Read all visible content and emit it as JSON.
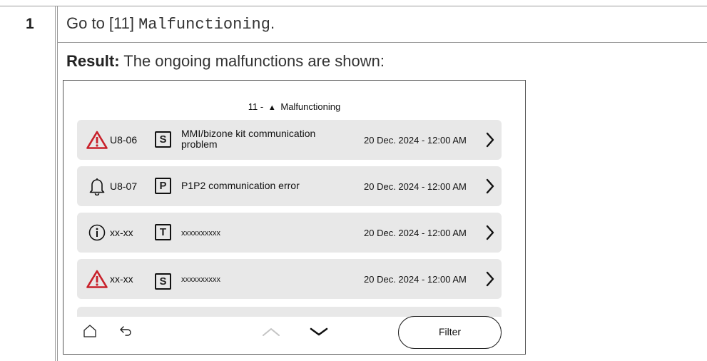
{
  "step": {
    "number": "1",
    "instruction_prefix": "Go to [11] ",
    "instruction_menu": "Malfunctioning",
    "instruction_suffix": ".",
    "result_label": "Result:",
    "result_text": " The ongoing malfunctions are shown:"
  },
  "screen": {
    "title_prefix": "11 -",
    "title_text": "Malfunctioning",
    "title_icon": "warning-triangle-icon",
    "rows": [
      {
        "severity_icon": "error-triangle-icon",
        "code": "U8-06",
        "category": "S",
        "description": "MMI/bizone kit communication problem",
        "datetime": "20 Dec. 2024 - 12:00 AM"
      },
      {
        "severity_icon": "bell-icon",
        "code": "U8-07",
        "category": "P",
        "description": "P1P2 communication error",
        "datetime": "20 Dec. 2024 - 12:00 AM"
      },
      {
        "severity_icon": "info-icon",
        "code": "xx-xx",
        "category": "T",
        "description": "xxxxxxxxxx",
        "datetime": "20 Dec. 2024 - 12:00 AM"
      },
      {
        "severity_icon": "error-triangle-icon",
        "code": "xx-xx",
        "category": "S",
        "description": "xxxxxxxxxx",
        "datetime": "20 Dec. 2024 - 12:00 AM"
      }
    ],
    "filter_label": "Filter"
  },
  "colors": {
    "error_red": "#c8202a",
    "row_background": "#e8e8e8",
    "rule_gray": "#9a9a9a"
  }
}
